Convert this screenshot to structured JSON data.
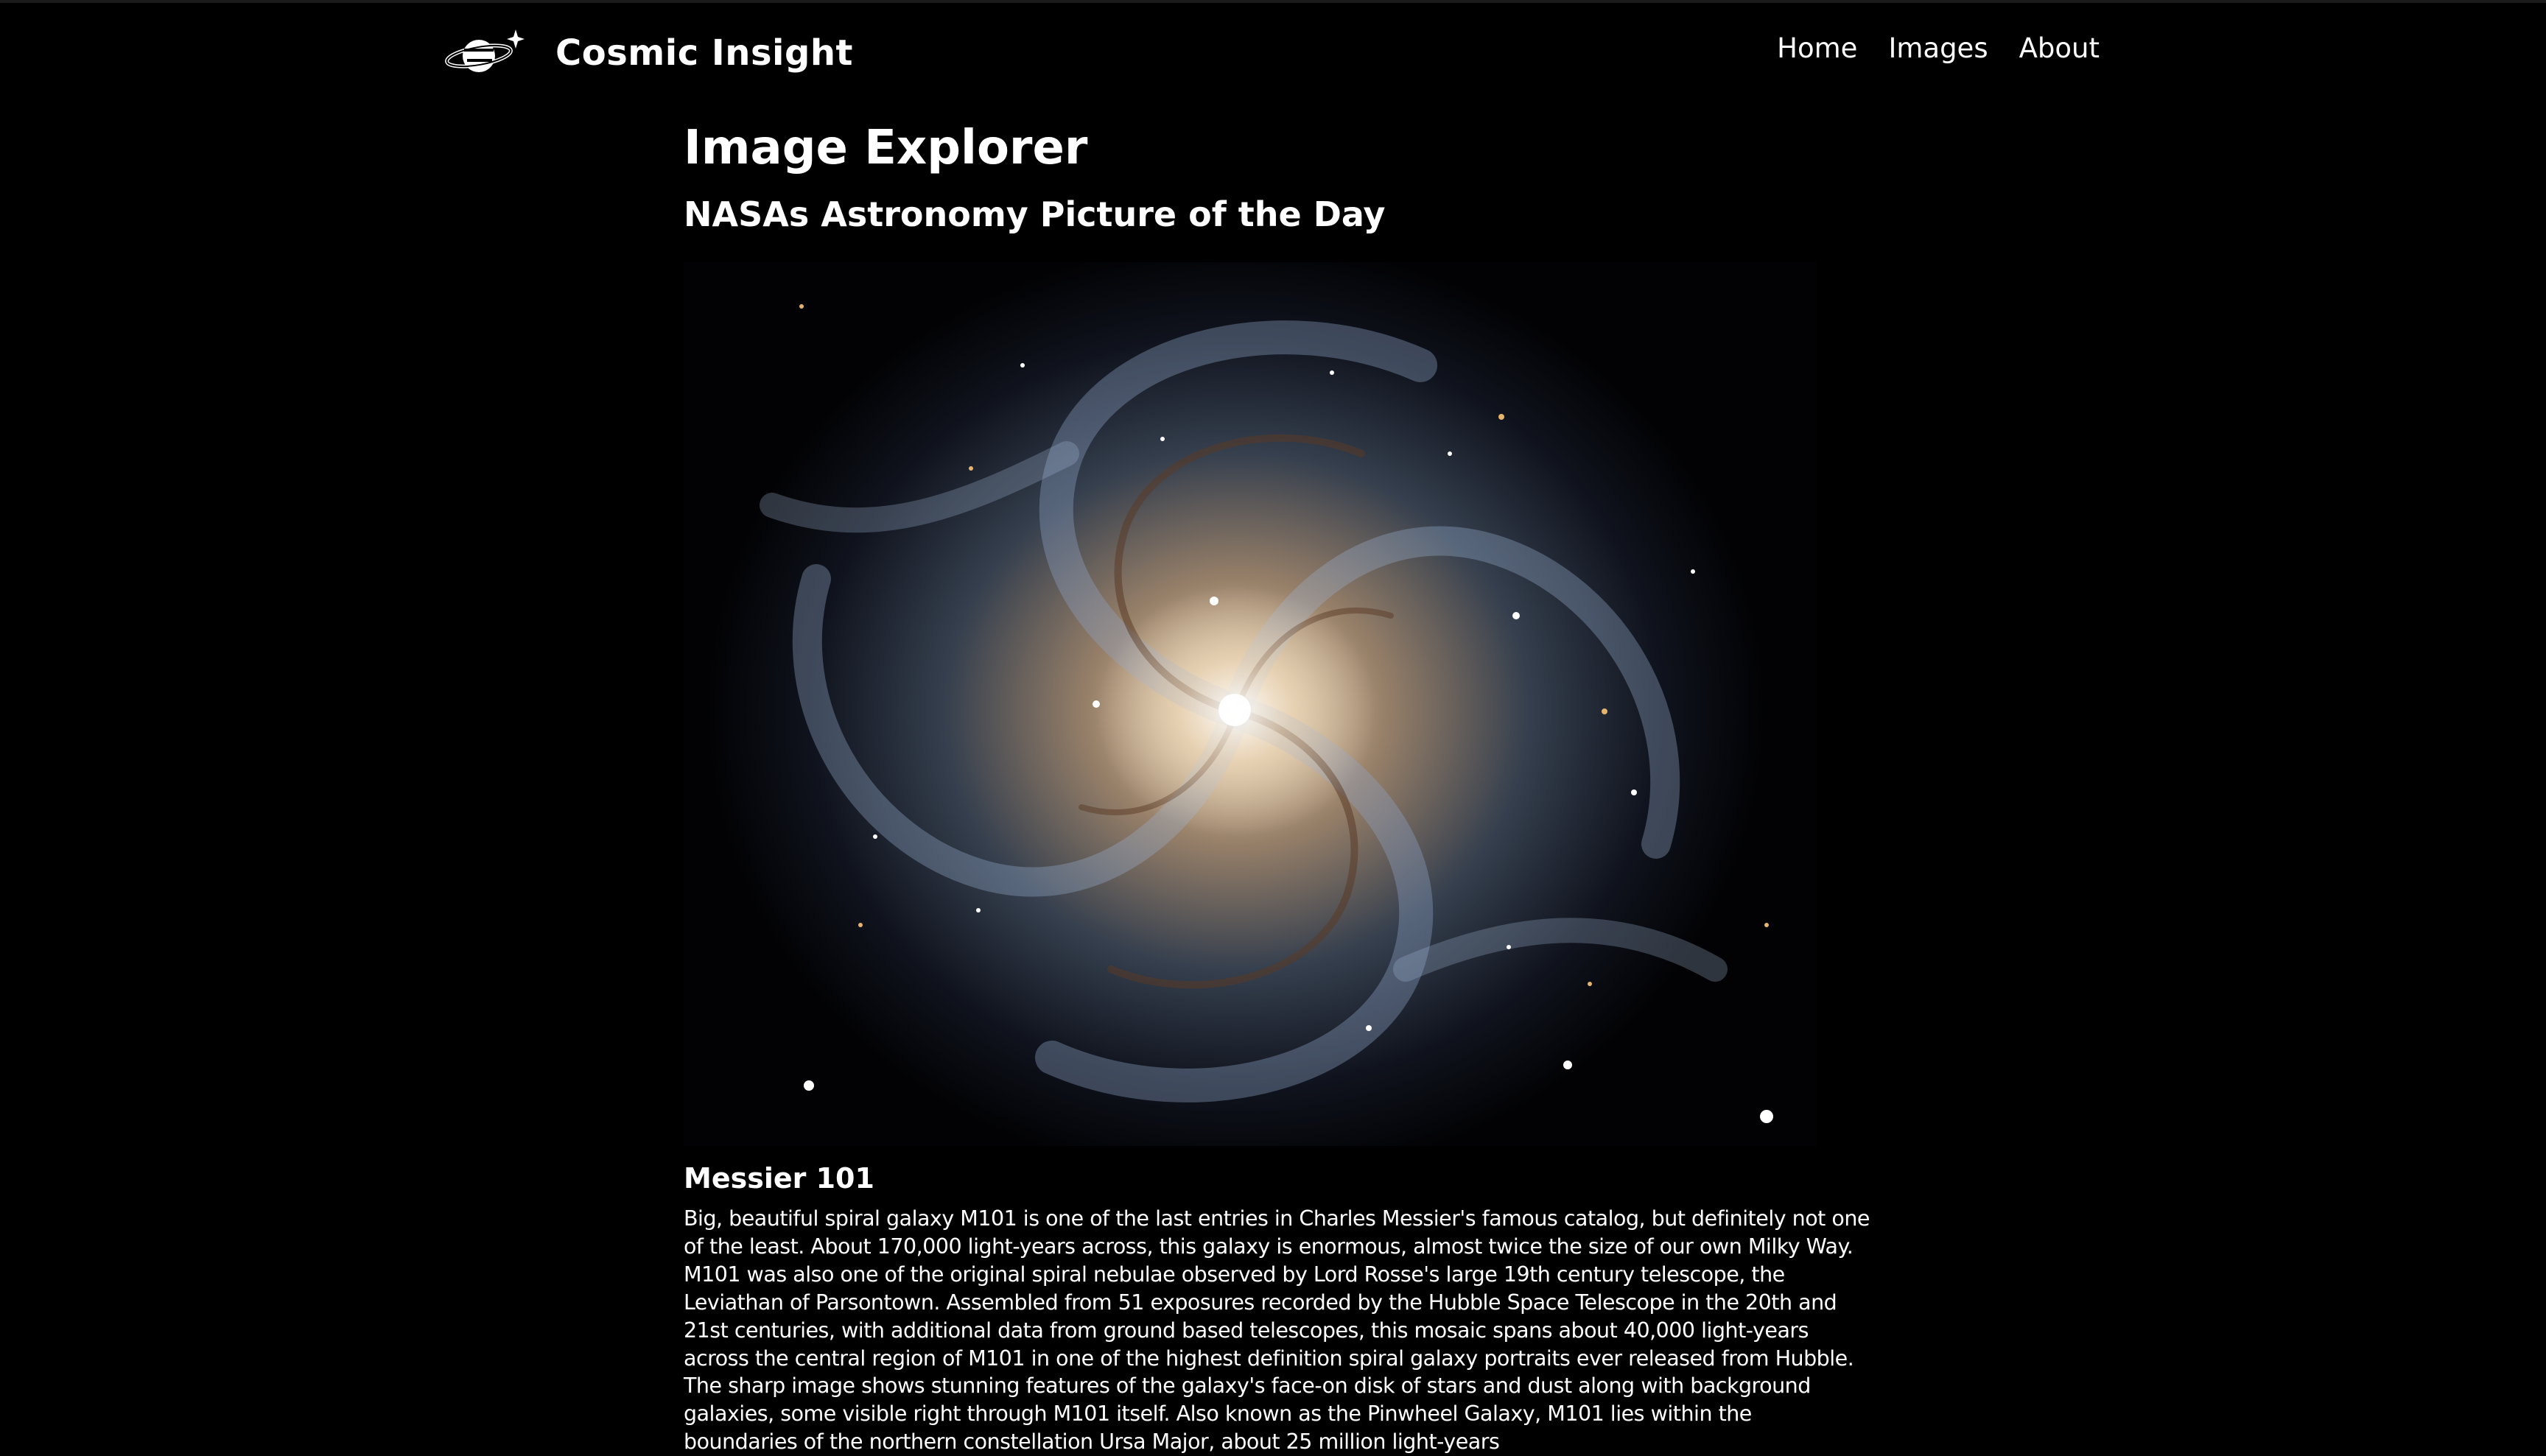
{
  "header": {
    "brand_name": "Cosmic Insight",
    "logo_icon": "planet-star-icon",
    "nav": [
      {
        "label": "Home"
      },
      {
        "label": "Images"
      },
      {
        "label": "About"
      }
    ]
  },
  "main": {
    "page_title": "Image Explorer",
    "section_title": "NASAs Astronomy Picture of the Day",
    "image": {
      "alt": "Messier 101",
      "title": "Messier 101",
      "explanation": "Big, beautiful spiral galaxy M101 is one of the last entries in Charles Messier's famous catalog, but definitely not one of the least. About 170,000 light-years across, this galaxy is enormous, almost twice the size of our own Milky Way. M101 was also one of the original spiral nebulae observed by Lord Rosse's large 19th century telescope, the Leviathan of Parsontown. Assembled from 51 exposures recorded by the Hubble Space Telescope in the 20th and 21st centuries, with additional data from ground based telescopes, this mosaic spans about 40,000 light-years across the central region of M101 in one of the highest definition spiral galaxy portraits ever released from Hubble. The sharp image shows stunning features of the galaxy's face-on disk of stars and dust along with background galaxies, some visible right through M101 itself. Also known as the Pinwheel Galaxy, M101 lies within the boundaries of the northern constellation Ursa Major, about 25 million light-years"
    }
  },
  "colors": {
    "background": "#000000",
    "text": "#ffffff"
  }
}
